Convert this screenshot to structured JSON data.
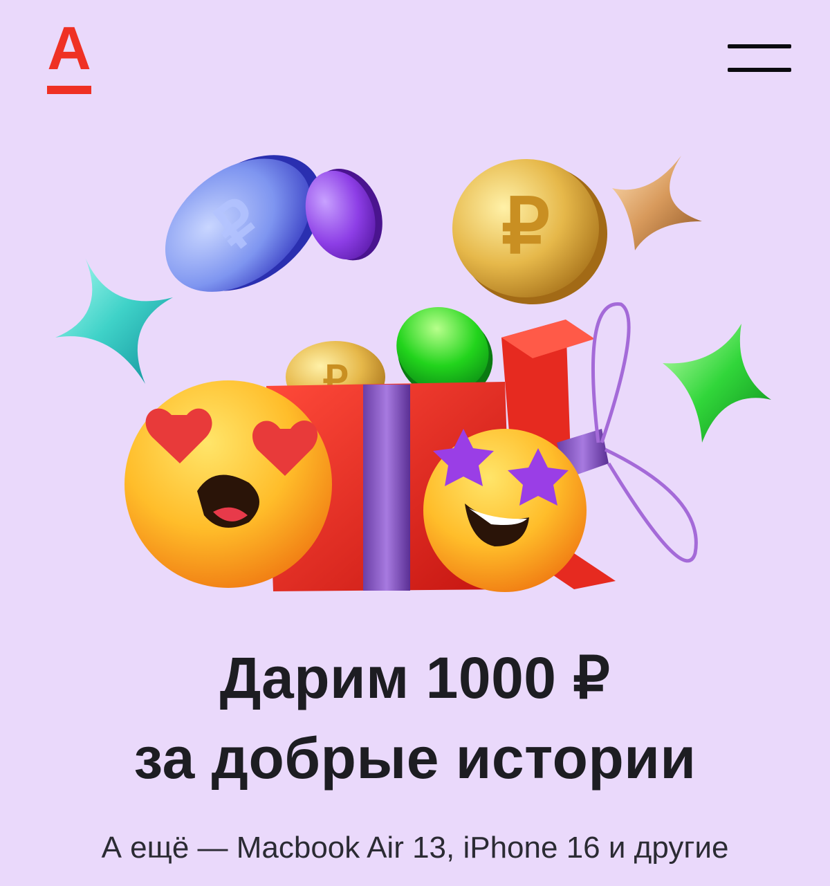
{
  "colors": {
    "background": "#ead9fb",
    "accent": "#ef3124",
    "title_text": "#1d1d22",
    "subtitle_text": "#2b2b33"
  },
  "header": {
    "logo_letter": "А",
    "logo_icon": "alfa-bank-logo-icon",
    "menu_icon": "hamburger-menu-icon"
  },
  "hero": {
    "illustration": "gift-box-with-coins-and-emoji-icon",
    "coin_symbol": "₽"
  },
  "main": {
    "title_line1": "Дарим 1000 ₽",
    "title_line2": "за добрые истории",
    "subtitle": "А ещё — Macbook Air 13, iPhone 16 и другие"
  }
}
